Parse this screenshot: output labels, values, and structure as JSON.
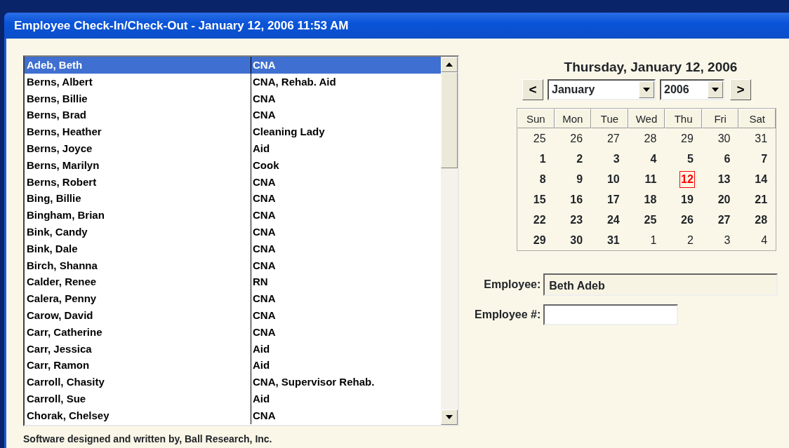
{
  "window": {
    "title": "Employee Check-In/Check-Out - January 12, 2006  11:53 AM"
  },
  "employees": [
    {
      "name": "Adeb, Beth",
      "role": "CNA",
      "selected": true
    },
    {
      "name": "Berns, Albert",
      "role": "CNA, Rehab. Aid",
      "selected": false
    },
    {
      "name": "Berns, Billie",
      "role": "CNA",
      "selected": false
    },
    {
      "name": "Berns, Brad",
      "role": "CNA",
      "selected": false
    },
    {
      "name": "Berns, Heather",
      "role": "Cleaning Lady",
      "selected": false
    },
    {
      "name": "Berns, Joyce",
      "role": "Aid",
      "selected": false
    },
    {
      "name": "Berns, Marilyn",
      "role": "Cook",
      "selected": false
    },
    {
      "name": "Berns, Robert",
      "role": "CNA",
      "selected": false
    },
    {
      "name": "Bing, Billie",
      "role": "CNA",
      "selected": false
    },
    {
      "name": "Bingham, Brian",
      "role": "CNA",
      "selected": false
    },
    {
      "name": "Bink, Candy",
      "role": "CNA",
      "selected": false
    },
    {
      "name": "Bink, Dale",
      "role": "CNA",
      "selected": false
    },
    {
      "name": "Birch, Shanna",
      "role": "CNA",
      "selected": false
    },
    {
      "name": "Calder, Renee",
      "role": "RN",
      "selected": false
    },
    {
      "name": "Calera, Penny",
      "role": "CNA",
      "selected": false
    },
    {
      "name": "Carow, David",
      "role": "CNA",
      "selected": false
    },
    {
      "name": "Carr, Catherine",
      "role": "CNA",
      "selected": false
    },
    {
      "name": "Carr, Jessica",
      "role": "Aid",
      "selected": false
    },
    {
      "name": "Carr, Ramon",
      "role": "Aid",
      "selected": false
    },
    {
      "name": "Carroll, Chasity",
      "role": "CNA, Supervisor Rehab.",
      "selected": false
    },
    {
      "name": "Carroll, Sue",
      "role": "Aid",
      "selected": false
    },
    {
      "name": "Chorak, Chelsey",
      "role": "CNA",
      "selected": false
    }
  ],
  "calendar": {
    "heading": "Thursday, January 12, 2006",
    "prev_button": "<",
    "next_button": ">",
    "month": "January",
    "year": "2006",
    "weekdays": [
      "Sun",
      "Mon",
      "Tue",
      "Wed",
      "Thu",
      "Fri",
      "Sat"
    ],
    "weeks": [
      [
        {
          "day": "25",
          "in_month": false,
          "selected": false
        },
        {
          "day": "26",
          "in_month": false,
          "selected": false
        },
        {
          "day": "27",
          "in_month": false,
          "selected": false
        },
        {
          "day": "28",
          "in_month": false,
          "selected": false
        },
        {
          "day": "29",
          "in_month": false,
          "selected": false
        },
        {
          "day": "30",
          "in_month": false,
          "selected": false
        },
        {
          "day": "31",
          "in_month": false,
          "selected": false
        }
      ],
      [
        {
          "day": "1",
          "in_month": true,
          "selected": false
        },
        {
          "day": "2",
          "in_month": true,
          "selected": false
        },
        {
          "day": "3",
          "in_month": true,
          "selected": false
        },
        {
          "day": "4",
          "in_month": true,
          "selected": false
        },
        {
          "day": "5",
          "in_month": true,
          "selected": false
        },
        {
          "day": "6",
          "in_month": true,
          "selected": false
        },
        {
          "day": "7",
          "in_month": true,
          "selected": false
        }
      ],
      [
        {
          "day": "8",
          "in_month": true,
          "selected": false
        },
        {
          "day": "9",
          "in_month": true,
          "selected": false
        },
        {
          "day": "10",
          "in_month": true,
          "selected": false
        },
        {
          "day": "11",
          "in_month": true,
          "selected": false
        },
        {
          "day": "12",
          "in_month": true,
          "selected": true
        },
        {
          "day": "13",
          "in_month": true,
          "selected": false
        },
        {
          "day": "14",
          "in_month": true,
          "selected": false
        }
      ],
      [
        {
          "day": "15",
          "in_month": true,
          "selected": false
        },
        {
          "day": "16",
          "in_month": true,
          "selected": false
        },
        {
          "day": "17",
          "in_month": true,
          "selected": false
        },
        {
          "day": "18",
          "in_month": true,
          "selected": false
        },
        {
          "day": "19",
          "in_month": true,
          "selected": false
        },
        {
          "day": "20",
          "in_month": true,
          "selected": false
        },
        {
          "day": "21",
          "in_month": true,
          "selected": false
        }
      ],
      [
        {
          "day": "22",
          "in_month": true,
          "selected": false
        },
        {
          "day": "23",
          "in_month": true,
          "selected": false
        },
        {
          "day": "24",
          "in_month": true,
          "selected": false
        },
        {
          "day": "25",
          "in_month": true,
          "selected": false
        },
        {
          "day": "26",
          "in_month": true,
          "selected": false
        },
        {
          "day": "27",
          "in_month": true,
          "selected": false
        },
        {
          "day": "28",
          "in_month": true,
          "selected": false
        }
      ],
      [
        {
          "day": "29",
          "in_month": true,
          "selected": false
        },
        {
          "day": "30",
          "in_month": true,
          "selected": false
        },
        {
          "day": "31",
          "in_month": true,
          "selected": false
        },
        {
          "day": "1",
          "in_month": false,
          "selected": false
        },
        {
          "day": "2",
          "in_month": false,
          "selected": false
        },
        {
          "day": "3",
          "in_month": false,
          "selected": false
        },
        {
          "day": "4",
          "in_month": false,
          "selected": false
        }
      ]
    ]
  },
  "form": {
    "employee_label": "Employee:",
    "employee_value": "Beth Adeb",
    "number_label": "Employee #:"
  },
  "footer": "Software designed and written by, Ball Research, Inc."
}
